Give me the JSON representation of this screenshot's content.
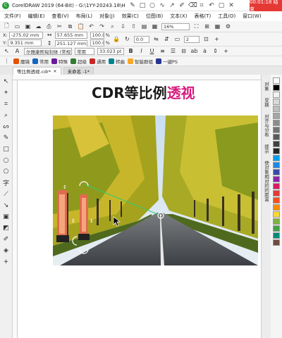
{
  "titlebar": {
    "title": "CorelDRAW 2019 (64-Bit) - G:\\1YY-20243.18\\H-和至公司",
    "record_time": "00:01:18 结束",
    "tools": [
      "pen-icon",
      "rectangle-icon",
      "ellipse-icon",
      "curve-icon",
      "arrow-icon",
      "pen-icon",
      "eraser-icon",
      "crop-icon",
      "undo-icon",
      "square-icon",
      "close-icon"
    ]
  },
  "menu": [
    "文件(F)",
    "编辑(E)",
    "查看(V)",
    "布局(L)",
    "对象(J)",
    "效果(C)",
    "位图(B)",
    "文本(X)",
    "表格(T)",
    "工具(O)",
    "窗口(W)",
    "帮助(H)"
  ],
  "toolbar": {
    "zoom": "16%"
  },
  "propbar": {
    "x": "-275.02 mm",
    "y": "9.351 mm",
    "width": "57.655 mm",
    "height": "251.127 mm",
    "scale_x": "100.0",
    "scale_y": "100.0",
    "percent": "%",
    "angle": "0.0",
    "outline": "2"
  },
  "textbar": {
    "font": "尔雅康熙甸刻体 (常规)",
    "style": "常用",
    "size": "33.023 pt",
    "bold": "B",
    "italic": "I",
    "underline": "U",
    "ab": "ab"
  },
  "plugins": [
    "魔镜",
    "常用",
    "特殊",
    "超级",
    "通用",
    "转曲",
    "智能群组",
    "一键PS"
  ],
  "tabs": [
    {
      "label": "等比例透视.cdr*",
      "active": true
    },
    {
      "label": "未命名 -1*",
      "active": false
    }
  ],
  "canvas": {
    "title_plain": "CDR等比例",
    "title_accent": "透视",
    "accent_color": "#d81b7e"
  },
  "dockers": [
    "对象",
    "变换",
    "对齐与分布",
    "提示",
    "使对象相对的的距离"
  ],
  "palette": [
    "#ffffff",
    "#000000",
    "#f2f2f2",
    "#d9d9d9",
    "#bfbfbf",
    "#a6a6a6",
    "#8c8c8c",
    "#737373",
    "#595959",
    "#404040",
    "#262626",
    "#00a0e9",
    "#1e88e5",
    "#3949ab",
    "#8e24aa",
    "#d81b60",
    "#e53935",
    "#f4511e",
    "#fb8c00",
    "#fdd835",
    "#7cb342",
    "#43a047",
    "#00897b",
    "#6d4c41"
  ]
}
